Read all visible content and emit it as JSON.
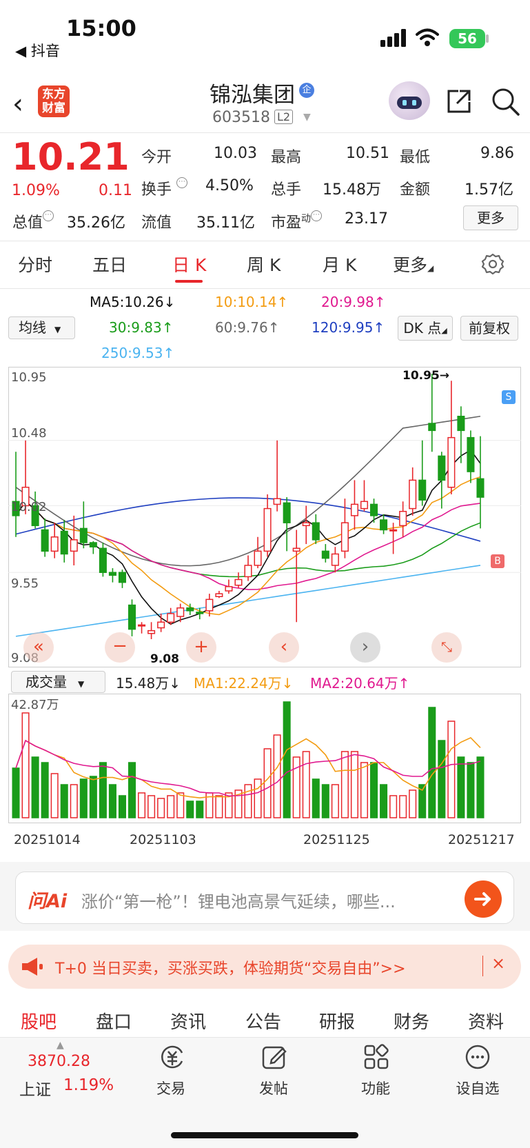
{
  "status": {
    "time": "15:00",
    "back_app": "◀ 抖音",
    "battery": "56"
  },
  "header": {
    "logo": [
      "东方",
      "财富"
    ],
    "stock_name": "锦泓集团",
    "ent_badge": "企",
    "code": "603518",
    "level": "L2"
  },
  "quote": {
    "price": "10.21",
    "change_pct": "1.09%",
    "change_amt": "0.11",
    "open_label": "今开",
    "open": "10.03",
    "high_label": "最高",
    "high": "10.51",
    "low_label": "最低",
    "low": "9.86",
    "turnover_label": "换手",
    "turnover": "4.50%",
    "volume_label": "总手",
    "volume": "15.48万",
    "amount_label": "金额",
    "amount": "1.57亿",
    "mktcap_label": "总值",
    "mktcap": "35.26亿",
    "float_label": "流值",
    "float_cap": "35.11亿",
    "pe_label": "市盈",
    "pe_sup": "动",
    "pe": "23.17",
    "more": "更多"
  },
  "tabs": [
    {
      "label": "分时"
    },
    {
      "label": "五日"
    },
    {
      "label": "日 K"
    },
    {
      "label": "周 K"
    },
    {
      "label": "月 K"
    },
    {
      "label": "更多"
    }
  ],
  "ma": {
    "select": "均线",
    "ma5": "MA5:10.26",
    "ma10": "10:10.14",
    "ma20": "20:9.98",
    "ma30": "30:9.83",
    "ma60": "60:9.76",
    "ma120": "120:9.95",
    "ma250": "250:9.53",
    "dk_btn": "DK 点",
    "adj_btn": "前复权",
    "colors": {
      "ma5": "#111111",
      "ma10": "#f39c12",
      "ma20": "#e0198f",
      "ma30": "#1a9c1a",
      "ma60": "#666666",
      "ma120": "#1f3fc0",
      "ma250": "#4ab3f0"
    }
  },
  "kline": {
    "y_labels": [
      "10.95",
      "10.48",
      "10.02",
      "9.55",
      "9.08"
    ],
    "high_marker": "10.95→",
    "low_marker": "9.08",
    "sell_badge": "S",
    "buy_badge": "B"
  },
  "volume": {
    "select": "成交量",
    "value": "15.48万",
    "ma1": "MA1:22.24万",
    "ma2": "MA2:20.64万",
    "max_label": "42.87万",
    "dates": [
      "20251014",
      "20251103",
      "20251125",
      "20251217"
    ]
  },
  "chart_data": {
    "type": "candlestick",
    "ylim": [
      9.08,
      10.95
    ],
    "candles": [
      [
        10.05,
        9.95,
        10.4,
        9.8
      ],
      [
        10.02,
        10.15,
        10.48,
        9.96
      ],
      [
        10.02,
        9.88,
        10.12,
        9.86
      ],
      [
        9.85,
        9.7,
        9.93,
        9.66
      ],
      [
        9.7,
        9.8,
        9.9,
        9.65
      ],
      [
        9.84,
        9.68,
        9.92,
        9.62
      ],
      [
        9.7,
        9.78,
        9.95,
        9.6
      ],
      [
        9.86,
        9.76,
        10.05,
        9.72
      ],
      [
        9.76,
        9.73,
        9.77,
        9.68
      ],
      [
        9.72,
        9.55,
        9.76,
        9.52
      ],
      [
        9.55,
        9.53,
        9.58,
        9.48
      ],
      [
        9.55,
        9.48,
        9.57,
        9.44
      ],
      [
        9.32,
        9.15,
        9.36,
        9.1
      ],
      [
        9.18,
        9.18,
        9.2,
        9.12
      ],
      [
        9.12,
        9.14,
        9.2,
        9.08
      ],
      [
        9.16,
        9.2,
        9.26,
        9.13
      ],
      [
        9.2,
        9.26,
        9.3,
        9.18
      ],
      [
        9.24,
        9.3,
        9.33,
        9.2
      ],
      [
        9.3,
        9.28,
        9.33,
        9.25
      ],
      [
        9.27,
        9.26,
        9.3,
        9.22
      ],
      [
        9.28,
        9.36,
        9.4,
        9.24
      ],
      [
        9.38,
        9.4,
        9.42,
        9.37
      ],
      [
        9.42,
        9.45,
        9.5,
        9.4
      ],
      [
        9.46,
        9.5,
        9.55,
        9.44
      ],
      [
        9.52,
        9.6,
        9.67,
        9.49
      ],
      [
        9.6,
        9.7,
        9.8,
        9.58
      ],
      [
        9.7,
        10.0,
        10.1,
        9.66
      ],
      [
        10.03,
        10.07,
        10.48,
        9.98
      ],
      [
        10.04,
        9.9,
        10.08,
        9.7
      ],
      [
        9.7,
        9.72,
        9.85,
        9.2
      ],
      [
        9.88,
        9.9,
        10.02,
        9.75
      ],
      [
        9.9,
        9.78,
        9.96,
        9.75
      ],
      [
        9.7,
        9.65,
        9.75,
        9.62
      ],
      [
        9.6,
        9.68,
        9.73,
        9.55
      ],
      [
        9.7,
        9.9,
        10.07,
        9.65
      ],
      [
        9.95,
        10.03,
        10.2,
        9.85
      ],
      [
        10.0,
        10.05,
        10.2,
        9.98
      ],
      [
        10.03,
        9.95,
        10.07,
        9.9
      ],
      [
        9.92,
        9.85,
        9.96,
        9.82
      ],
      [
        9.85,
        9.85,
        9.9,
        9.68
      ],
      [
        9.88,
        9.98,
        10.05,
        9.8
      ],
      [
        10.0,
        10.2,
        10.29,
        9.95
      ],
      [
        10.2,
        10.06,
        10.48,
        10.02
      ],
      [
        10.6,
        10.55,
        10.95,
        10.4
      ],
      [
        10.37,
        10.2,
        10.4,
        10.0
      ],
      [
        10.15,
        10.5,
        10.9,
        10.1
      ],
      [
        10.65,
        10.55,
        10.72,
        10.32
      ],
      [
        10.5,
        10.26,
        10.55,
        10.18
      ],
      [
        10.21,
        10.08,
        10.51,
        9.86
      ]
    ],
    "volume": [
      18,
      38,
      22,
      20,
      16,
      12,
      12,
      14,
      15,
      20,
      12,
      8,
      20,
      9,
      8,
      7,
      8,
      9,
      6,
      6,
      9,
      8,
      9,
      10,
      12,
      14,
      25,
      30,
      42,
      22,
      24,
      14,
      12,
      12,
      24,
      24,
      20,
      20,
      12,
      8,
      8,
      10,
      12,
      40,
      28,
      35,
      22,
      20,
      22
    ]
  },
  "ai": {
    "logo": "问Ai",
    "text": "涨价“第一枪”！锂电池高景气延续，哪些..."
  },
  "promo": {
    "text": "T+0 当日买卖，买涨买跌，体验期货“交易自由”>>",
    "close": "×"
  },
  "sub_tabs": [
    {
      "label": "股吧"
    },
    {
      "label": "盘口"
    },
    {
      "label": "资讯"
    },
    {
      "label": "公告"
    },
    {
      "label": "研报"
    },
    {
      "label": "财务"
    },
    {
      "label": "资料"
    }
  ],
  "bottom_nav": {
    "index_value": "3870.28",
    "index_name": "上证",
    "index_pct": "1.19%",
    "items": [
      {
        "label": "交易"
      },
      {
        "label": "发帖"
      },
      {
        "label": "功能"
      },
      {
        "label": "设自选"
      }
    ]
  }
}
